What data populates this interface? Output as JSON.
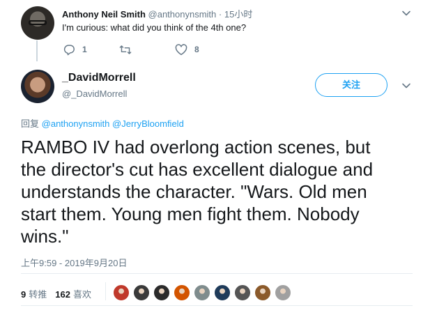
{
  "parent_tweet": {
    "author_name": "Anthony Neil Smith",
    "author_handle": "@anthonynsmith",
    "separator": "·",
    "time": "15小时",
    "text": "I'm curious: what did you think of the 4th one?",
    "reply_count": "1",
    "like_count": "8",
    "icons": [
      "reply-icon",
      "retweet-icon",
      "like-icon",
      "chevron-down-icon"
    ]
  },
  "main_tweet": {
    "author_name": "_DavidMorrell",
    "author_handle": "@_DavidMorrell",
    "follow_label": "关注",
    "reply_label": "回复",
    "reply_mentions": [
      "@anthonynsmith",
      "@JerryBloomfield"
    ],
    "text": "RAMBO IV had overlong action scenes, but\nthe director's cut has excellent dialogue and\nunderstands the character. \"Wars. Old men\nstart them. Young men  fight them. Nobody\nwins.\"",
    "timestamp": "上午9:59 - 2019年9月20日",
    "retweet_count": "9",
    "retweet_label": "转推",
    "like_count": "162",
    "like_label": "喜欢",
    "liker_avatar_colors": [
      "#c0392b",
      "#3a3a3a",
      "#2b2b2b",
      "#d35400",
      "#7f8c8d",
      "#1f3b5a",
      "#555555",
      "#8b5a2b",
      "#a0a0a0"
    ]
  },
  "colors": {
    "accent": "#1da1f2",
    "secondary_text": "#657786",
    "primary_text": "#14171a",
    "divider": "#e6ecf0"
  }
}
